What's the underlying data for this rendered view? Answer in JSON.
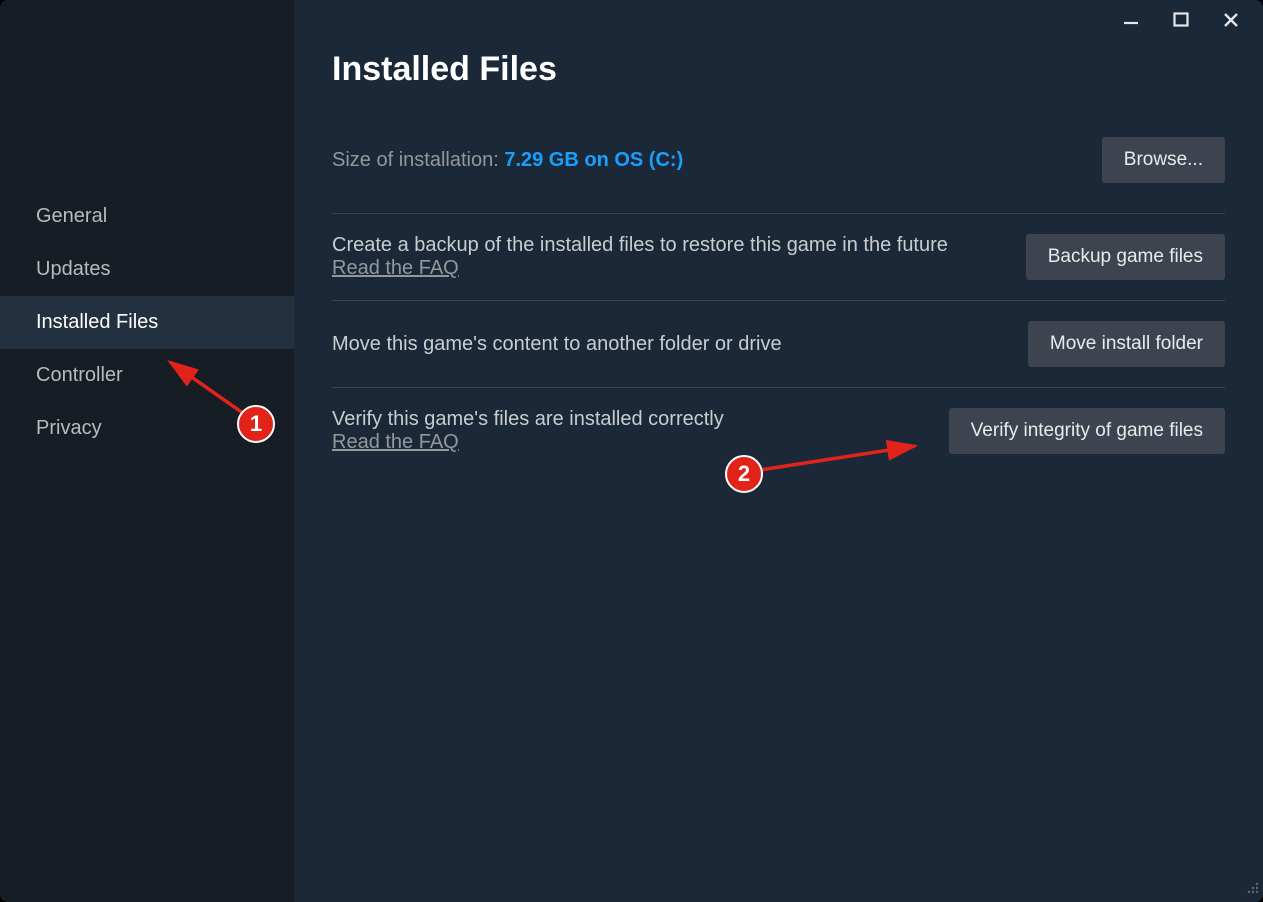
{
  "window_controls": {
    "minimize": "−",
    "maximize": "▢",
    "close": "✕"
  },
  "sidebar": {
    "items": [
      {
        "label": "General"
      },
      {
        "label": "Updates"
      },
      {
        "label": "Installed Files"
      },
      {
        "label": "Controller"
      },
      {
        "label": "Privacy"
      }
    ],
    "active_index": 2
  },
  "main": {
    "title": "Installed Files",
    "size_label": "Size of installation: ",
    "size_value": "7.29 GB on OS (C:)",
    "browse_button": "Browse...",
    "sections": [
      {
        "text": "Create a backup of the installed files to restore this game in the future",
        "faq": "Read the FAQ",
        "button": "Backup game files"
      },
      {
        "text": "Move this game's content to another folder or drive",
        "faq": "",
        "button": "Move install folder"
      },
      {
        "text": "Verify this game's files are installed correctly",
        "faq": "Read the FAQ",
        "button": "Verify integrity of game files"
      }
    ]
  },
  "annotations": {
    "badge1": "1",
    "badge2": "2"
  }
}
